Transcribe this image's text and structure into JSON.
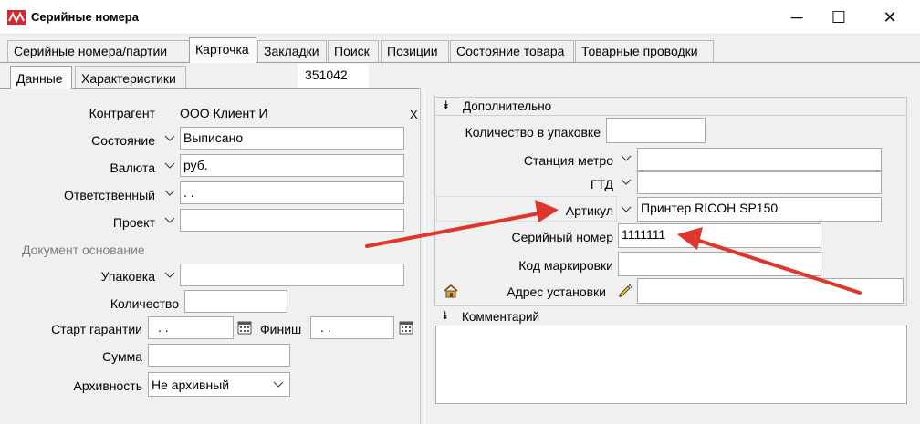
{
  "window": {
    "title": "Серийные номера",
    "minimize_glyph": "─",
    "maximize_glyph": "☐",
    "close_glyph": "✕",
    "logo_icon": "app-logo-icon"
  },
  "tabs": [
    {
      "label": "Серийные номера/партии"
    },
    {
      "label": "Карточка"
    },
    {
      "label": "Закладки"
    },
    {
      "label": "Поиск"
    },
    {
      "label": "Позиции"
    },
    {
      "label": "Состояние товара"
    },
    {
      "label": "Товарные проводки"
    }
  ],
  "subtabs": [
    {
      "label": "Данные"
    },
    {
      "label": "Характеристики"
    }
  ],
  "record_id": "351042",
  "left": {
    "kontragent_label": "Контрагент",
    "kontragent_value": "ООО Клиент И",
    "clear_glyph": "X",
    "sostoyanie_label": "Состояние",
    "sostoyanie_value": "Выписано",
    "valyuta_label": "Валюта",
    "valyuta_value": "руб.",
    "otvetstvenny_label": "Ответственный",
    "otvetstvenny_value": ". .",
    "proekt_label": "Проект",
    "proekt_value": "",
    "doc_osnovanie_label": "Документ основание",
    "upakovka_label": "Упаковка",
    "upakovka_value": "",
    "kolichestvo_label": "Количество",
    "kolichestvo_value": "",
    "start_label": "Старт гарантии",
    "start_value": ".  .",
    "finish_label": "Финиш",
    "finish_value": ".  .",
    "summa_label": "Сумма",
    "summa_value": "",
    "arkhivnost_label": "Архивность",
    "arkhivnost_value": "Не архивный"
  },
  "extra": {
    "title": "Дополнительно",
    "qty_pack_label": "Количество в упаковке",
    "qty_pack_value": "",
    "metro_label": "Станция метро",
    "metro_value": "",
    "gtd_label": "ГТД",
    "gtd_value": "",
    "artikul_label": "Артикул",
    "artikul_value": "Принтер RICOH SP150",
    "serial_label": "Серийный номер",
    "serial_value": "1111111",
    "marking_label": "Код маркировки",
    "marking_value": "",
    "address_label": "Адрес установки",
    "address_value": ""
  },
  "comment": {
    "title": "Комментарий",
    "value": ""
  },
  "colors": {
    "arrow": "#e0352b",
    "logo": "#d9262b"
  }
}
